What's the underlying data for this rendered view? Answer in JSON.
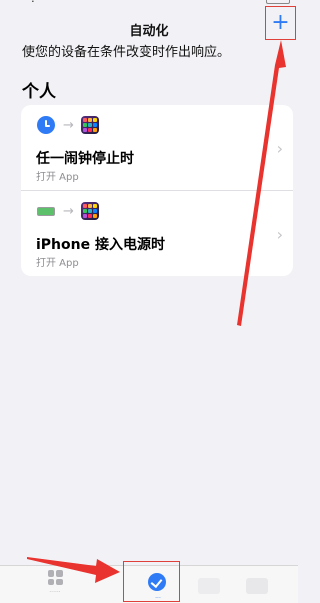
{
  "nav": {
    "title": "自动化",
    "add_label": "+"
  },
  "subtitle": "使您的设备在条件改变时作出响应。",
  "section": {
    "title": "个人"
  },
  "automations": [
    {
      "title": "任一闹钟停止时",
      "subtitle": "打开 App",
      "trigger_icon": "alarm-clock-icon",
      "action_icon": "app-grid-icon"
    },
    {
      "title": "iPhone 接入电源时",
      "subtitle": "打开 App",
      "trigger_icon": "battery-charging-icon",
      "action_icon": "app-grid-icon"
    }
  ],
  "tabbar": {
    "tabs": [
      {
        "icon": "gallery-grid-icon"
      },
      {
        "icon": "automation-check-icon"
      }
    ]
  },
  "colors": {
    "accent": "#2f7bf6",
    "highlight": "#e0403a",
    "background": "#f2f2f6"
  }
}
